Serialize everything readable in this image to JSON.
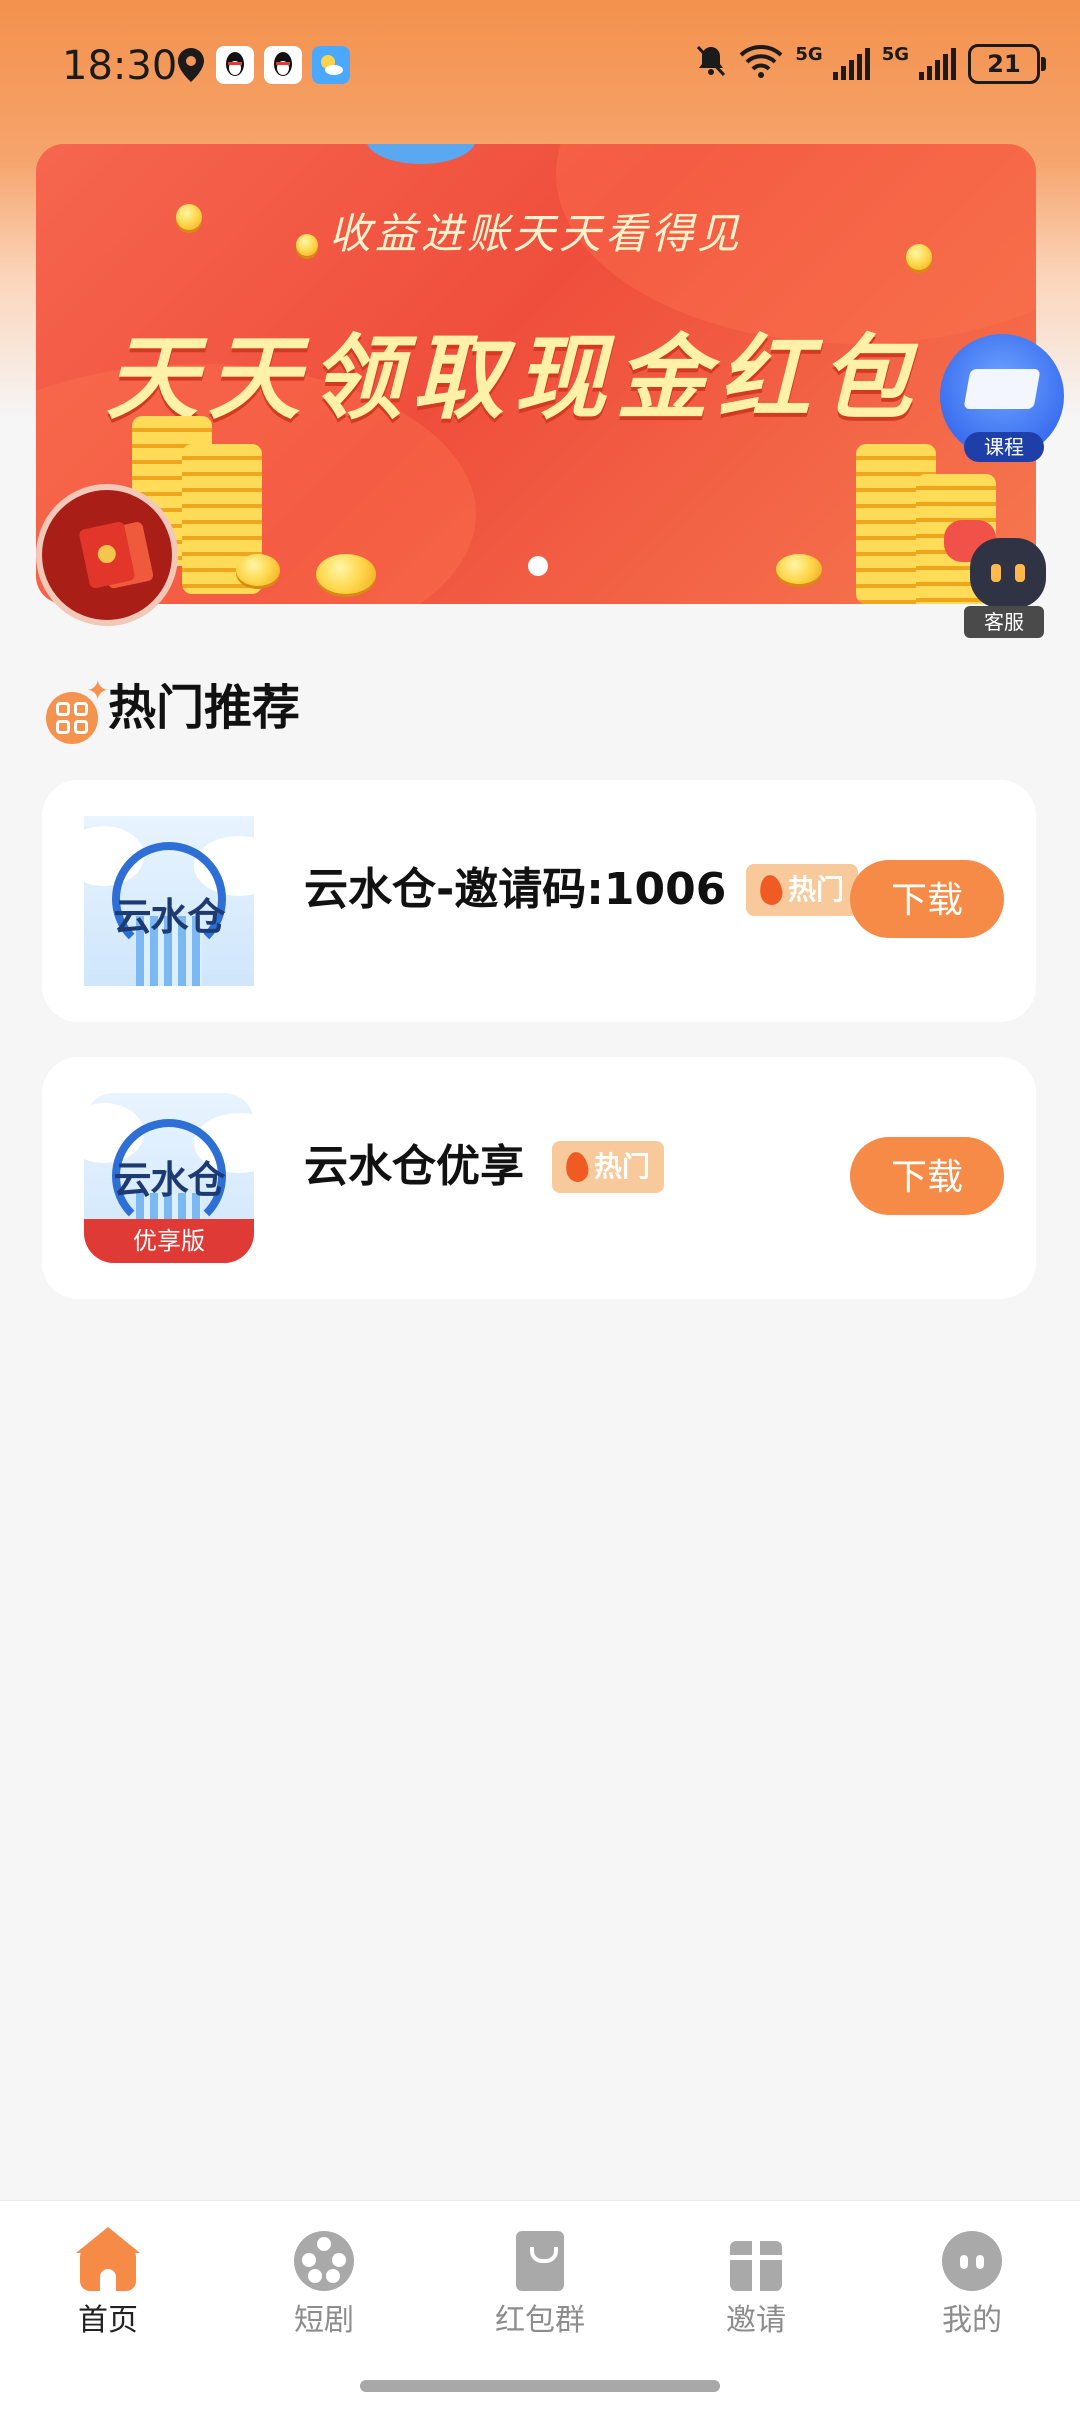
{
  "status_bar": {
    "time": "18:30",
    "signal_label_1": "5G",
    "signal_label_2": "5G",
    "battery": "21"
  },
  "banner": {
    "subtitle": "收益进账天天看得见",
    "title": "天天领取现金红包"
  },
  "floating": {
    "course_label": "课程",
    "service_label": "客服"
  },
  "section": {
    "title": "热门推荐"
  },
  "apps": [
    {
      "name": "云水仓-邀请码:1006",
      "icon_text": "云水仓",
      "badge": "热门",
      "button": "下载"
    },
    {
      "name": "云水仓优享",
      "icon_text": "云水仓",
      "icon_band": "优享版",
      "badge": "热门",
      "button": "下载"
    }
  ],
  "nav": {
    "items": [
      {
        "label": "首页",
        "icon": "home-icon",
        "active": true
      },
      {
        "label": "短剧",
        "icon": "film-reel-icon",
        "active": false
      },
      {
        "label": "红包群",
        "icon": "red-packet-icon",
        "active": false
      },
      {
        "label": "邀请",
        "icon": "gift-icon",
        "active": false
      },
      {
        "label": "我的",
        "icon": "profile-icon",
        "active": false
      }
    ]
  },
  "colors": {
    "accent": "#f68b48",
    "badge": "#f8c99a",
    "banner": "#ef4e3c"
  }
}
